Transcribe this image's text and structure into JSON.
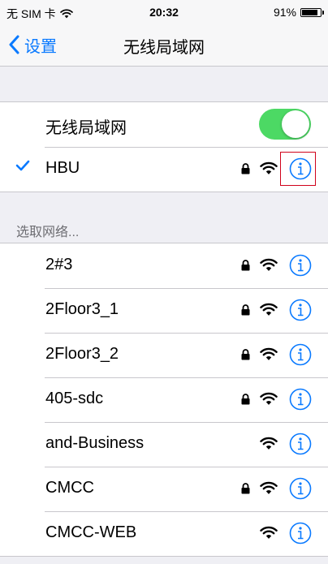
{
  "status_bar": {
    "carrier": "无 SIM 卡",
    "time": "20:32",
    "battery_text": "91%",
    "battery_level": 0.91
  },
  "nav": {
    "back_label": "设置",
    "title": "无线局域网"
  },
  "wifi_toggle": {
    "label": "无线局域网",
    "on": true
  },
  "connected": {
    "name": "HBU",
    "secured": true
  },
  "networks_header": "选取网络...",
  "networks": [
    {
      "name": "2#3",
      "secured": true
    },
    {
      "name": "2Floor3_1",
      "secured": true
    },
    {
      "name": "2Floor3_2",
      "secured": true
    },
    {
      "name": "405-sdc",
      "secured": true
    },
    {
      "name": "and-Business",
      "secured": false
    },
    {
      "name": "CMCC",
      "secured": true
    },
    {
      "name": "CMCC-WEB",
      "secured": false
    }
  ],
  "colors": {
    "accent": "#0a7aff",
    "toggle_on": "#4cd964",
    "highlight": "#d0021b"
  },
  "icons": {
    "back": "chevron-left-icon",
    "lock": "lock-icon",
    "wifi": "wifi-signal-icon",
    "info": "info-circle-icon",
    "check": "checkmark-icon"
  }
}
